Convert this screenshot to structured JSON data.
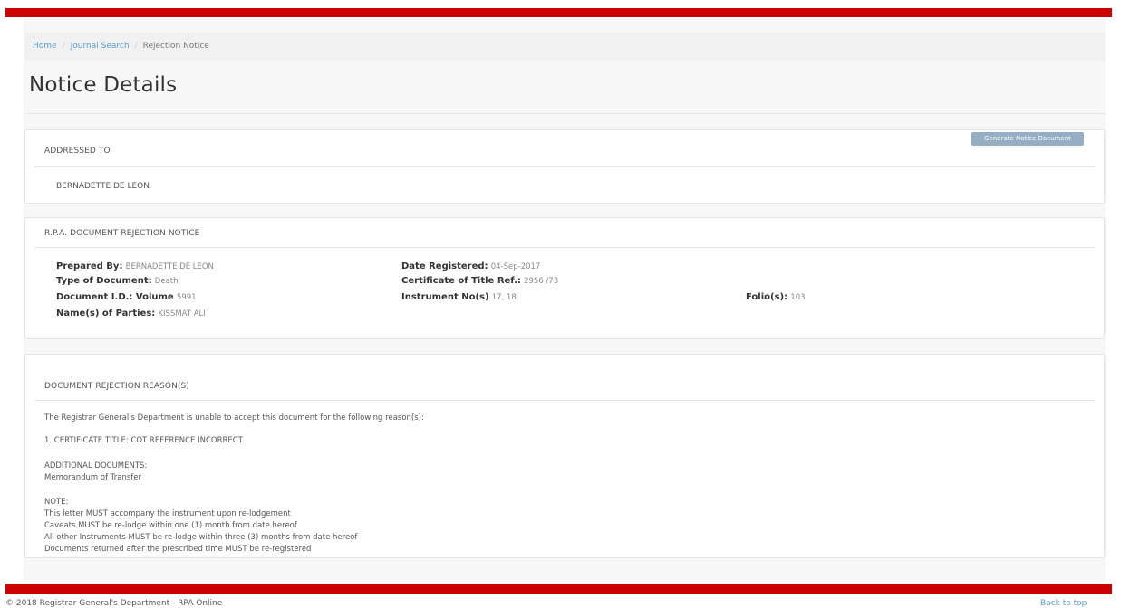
{
  "breadcrumb": {
    "items": [
      "Home",
      "Journal Search",
      "Rejection Notice"
    ],
    "separator": "/"
  },
  "page": {
    "title": "Notice Details"
  },
  "actions": {
    "generate_label": "Generate Notice Document"
  },
  "addressed": {
    "heading": "ADDRESSED TO",
    "name": "BERNADETTE DE LEON"
  },
  "notice": {
    "heading": "R.P.A. DOCUMENT REJECTION NOTICE",
    "prepared_by": {
      "label": "Prepared By:",
      "value": "BERNADETTE DE LEON"
    },
    "type_of_document": {
      "label": "Type of Document:",
      "value": "Death"
    },
    "document_id": {
      "label": "Document I.D.: Volume",
      "value": "5991"
    },
    "parties": {
      "label": "Name(s) of Parties:",
      "value": "KISSMAT ALI"
    },
    "date_registered": {
      "label": "Date Registered:",
      "value": "04-Sep-2017"
    },
    "certificate_ref": {
      "label": "Certificate of Title Ref.:",
      "value": "2956 /73"
    },
    "instrument_nos": {
      "label": "Instrument No(s)",
      "value": "17, 18"
    },
    "folios": {
      "label": "Folio(s):",
      "value": "103"
    }
  },
  "reasons": {
    "heading": "DOCUMENT REJECTION REASON(S)",
    "intro": "The Registrar General's Department is unable to accept this document for the following reason(s):",
    "items": [
      "1. CERTIFICATE TITLE: COT REFERENCE INCORRECT"
    ],
    "additional_heading": "ADDITIONAL DOCUMENTS:",
    "additional_items": [
      "Memorandum of Transfer"
    ],
    "note_heading": "NOTE:",
    "note_lines": [
      "This letter MUST accompany the instrument upon re-lodgement",
      "Caveats MUST be re-lodge within one (1) month from date hereof",
      "All other Instruments MUST be re-lodge within three (3) months from date hereof",
      "Documents returned after the prescribed time MUST be re-registered"
    ]
  },
  "footer": {
    "copyright": "© 2018 Registrar General's Department - RPA Online",
    "back_to_top": "Back to top"
  },
  "colors": {
    "brand_red": "#cc0000",
    "link_blue": "#5a9fd4",
    "button": "#95aec4"
  }
}
